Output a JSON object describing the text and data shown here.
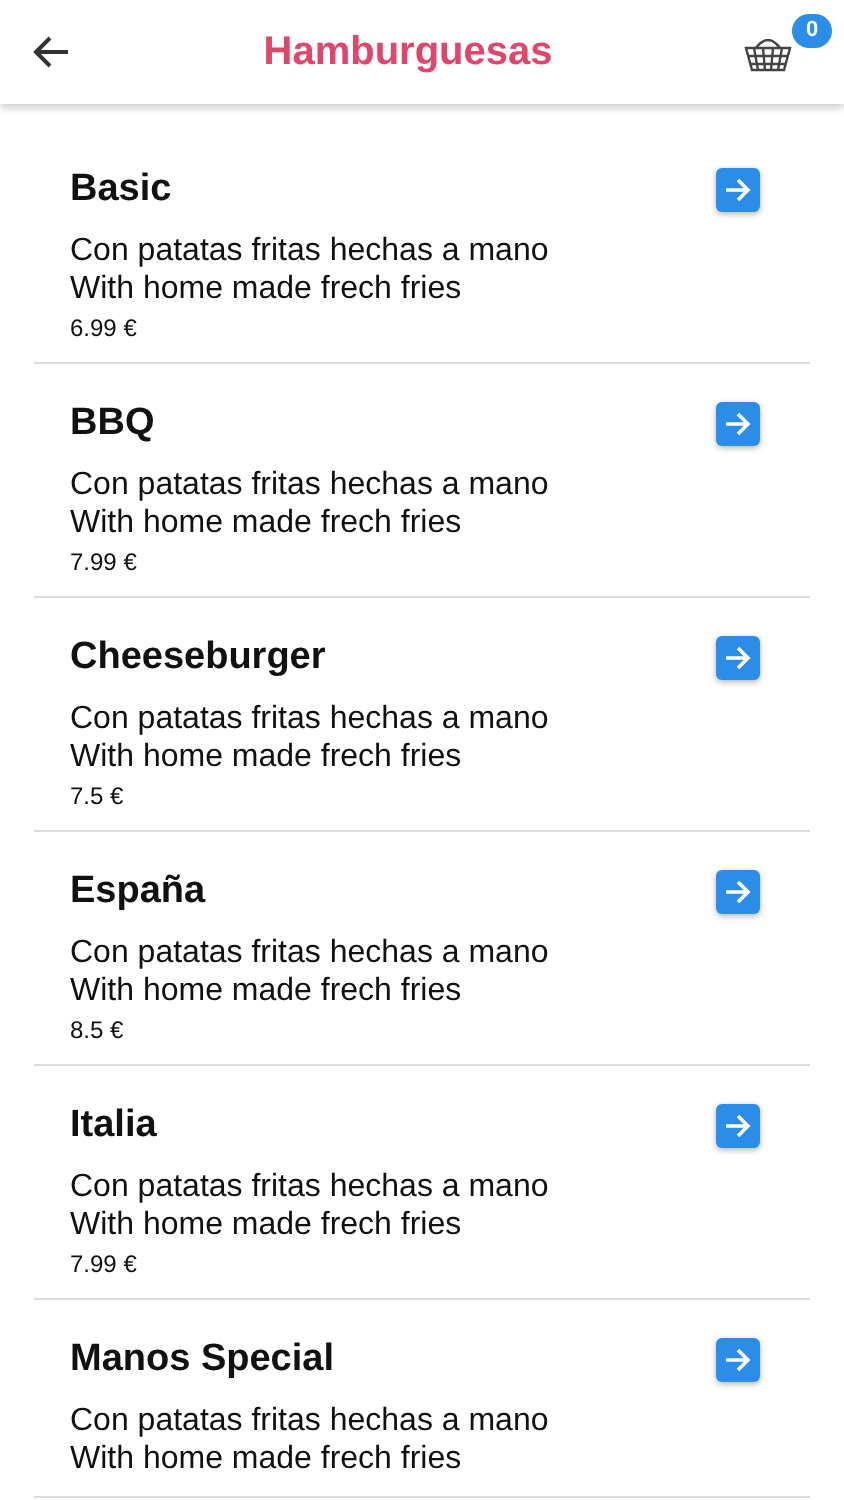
{
  "header": {
    "title": "Hamburguesas",
    "cart_count": "0"
  },
  "products": [
    {
      "name": "Basic",
      "description_es": "Con patatas fritas hechas a mano",
      "description_en": "With home made frech fries",
      "price": "6.99 €"
    },
    {
      "name": "BBQ",
      "description_es": "Con patatas fritas hechas a mano",
      "description_en": "With home made frech fries",
      "price": "7.99 €"
    },
    {
      "name": "Cheeseburger",
      "description_es": "Con patatas fritas hechas a mano",
      "description_en": "With home made frech fries",
      "price": "7.5 €"
    },
    {
      "name": "España",
      "description_es": "Con patatas fritas hechas a mano",
      "description_en": "With home made frech fries",
      "price": "8.5 €"
    },
    {
      "name": "Italia",
      "description_es": "Con patatas fritas hechas a mano",
      "description_en": "With home made frech fries",
      "price": "7.99 €"
    },
    {
      "name": "Manos Special",
      "description_es": "Con patatas fritas hechas a mano",
      "description_en": "With home made frech fries"
    }
  ]
}
